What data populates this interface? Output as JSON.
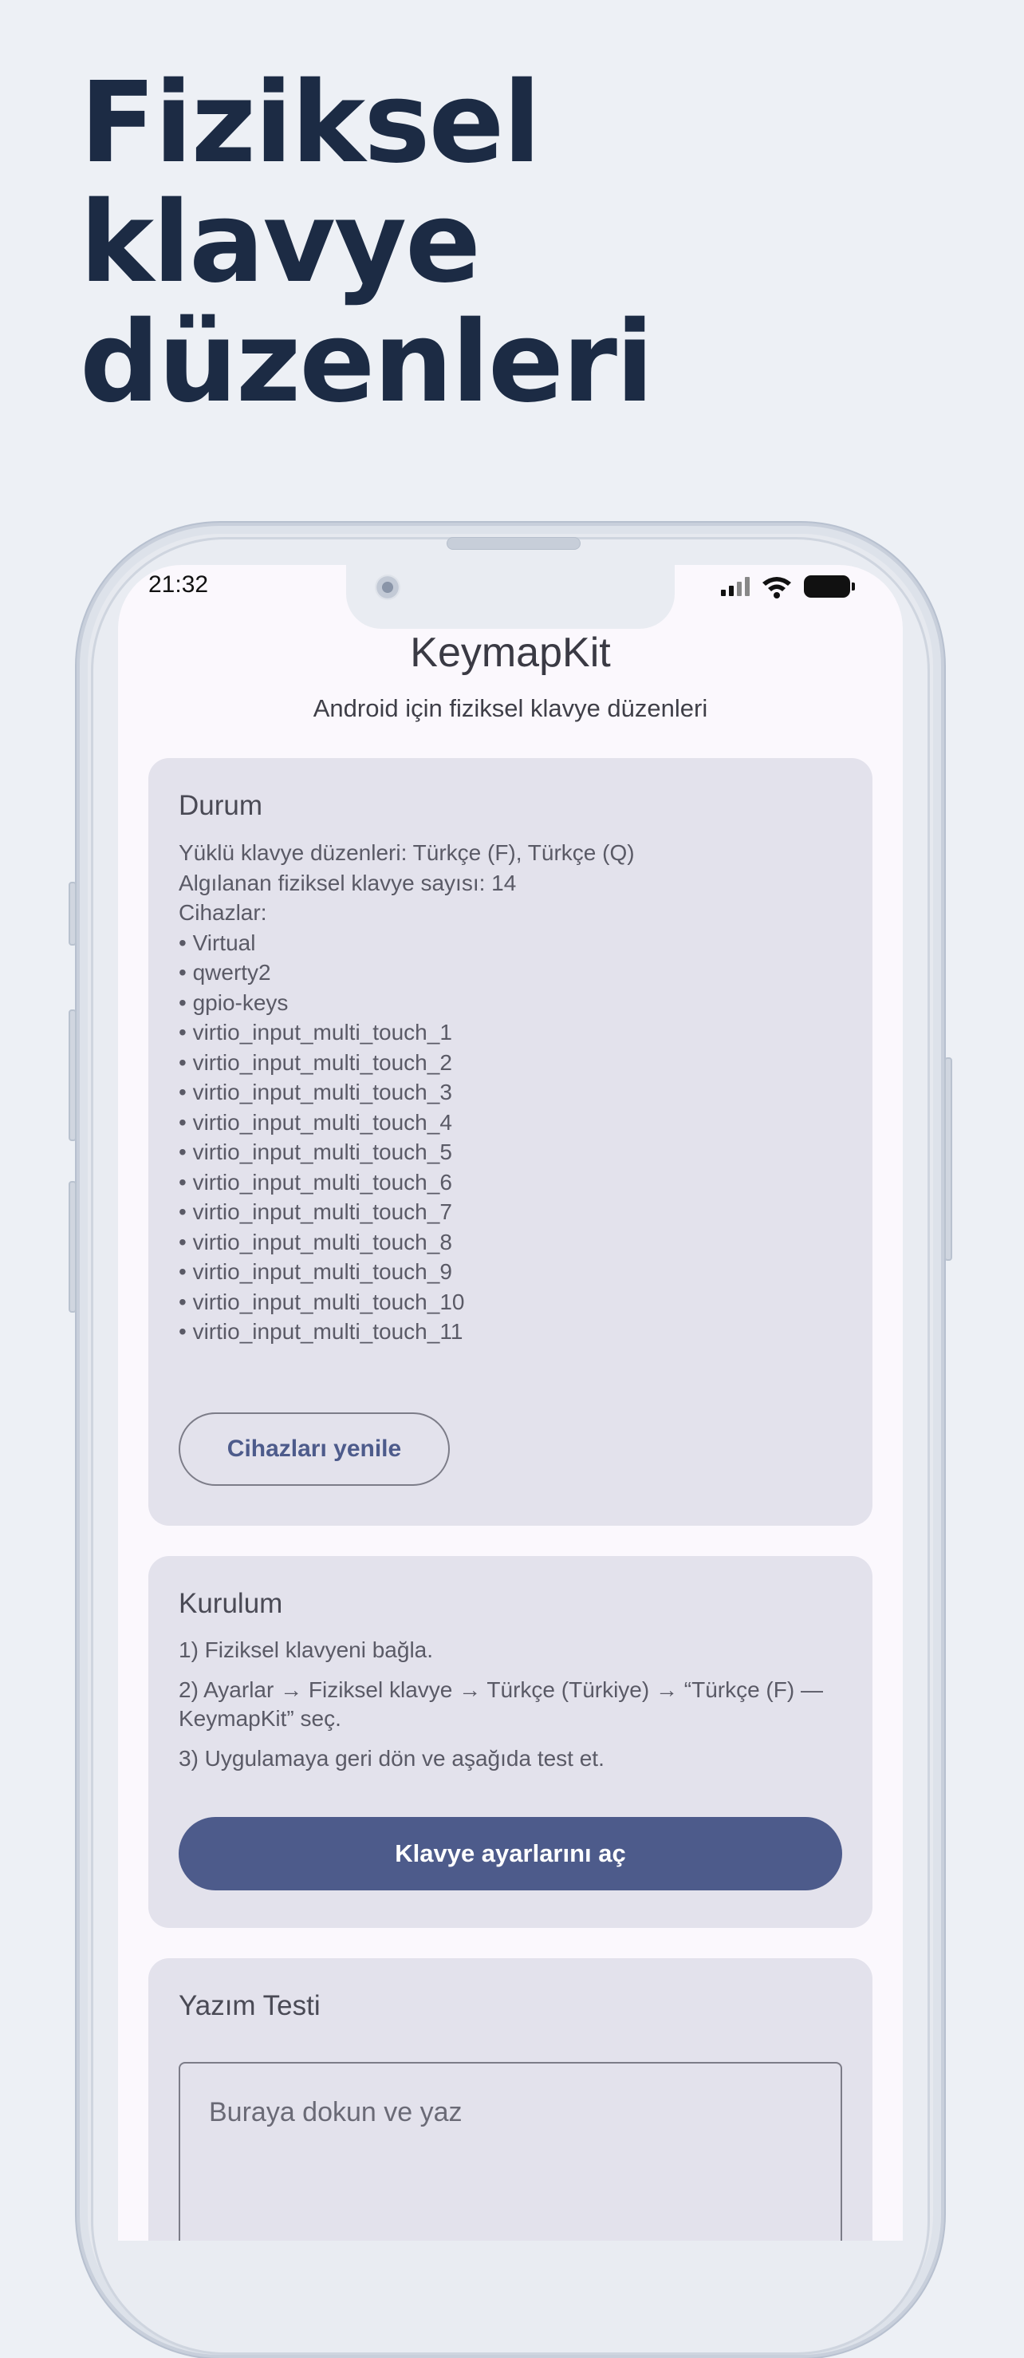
{
  "headline": [
    "Fiziksel",
    "klavye",
    "düzenleri"
  ],
  "status_bar": {
    "time": "21:32",
    "icons": [
      "signal-icon",
      "wifi-icon",
      "battery-icon"
    ]
  },
  "app": {
    "title": "KeymapKit",
    "subtitle": "Android için fiziksel klavye düzenleri"
  },
  "status_card": {
    "title": "Durum",
    "lines": [
      "Yüklü klavye düzenleri: Türkçe (F), Türkçe (Q)",
      "Algılanan fiziksel klavye sayısı: 14",
      "Cihazlar:",
      "• Virtual",
      "• qwerty2",
      "• gpio-keys",
      "• virtio_input_multi_touch_1",
      "• virtio_input_multi_touch_2",
      "• virtio_input_multi_touch_3",
      "• virtio_input_multi_touch_4",
      "• virtio_input_multi_touch_5",
      "• virtio_input_multi_touch_6",
      "• virtio_input_multi_touch_7",
      "• virtio_input_multi_touch_8",
      "• virtio_input_multi_touch_9",
      "• virtio_input_multi_touch_10",
      "• virtio_input_multi_touch_11"
    ],
    "refresh_label": "Cihazları yenile"
  },
  "setup_card": {
    "title": "Kurulum",
    "steps": [
      "1) Fiziksel klavyeni bağla.",
      "2) Ayarlar → Fiziksel klavye → Türkçe (Türkiye) → “Türkçe (F) — KeymapKit” seç.",
      "3) Uygulamaya geri dön ve aşağıda test et."
    ],
    "open_settings_label": "Klavye ayarlarını aç"
  },
  "test_card": {
    "title": "Yazım Testi",
    "placeholder": "Buraya dokun ve yaz"
  },
  "colors": {
    "background": "#edf0f5",
    "headline": "#1c2b44",
    "accent": "#4d5b8b",
    "card": "#e3e2ec"
  }
}
